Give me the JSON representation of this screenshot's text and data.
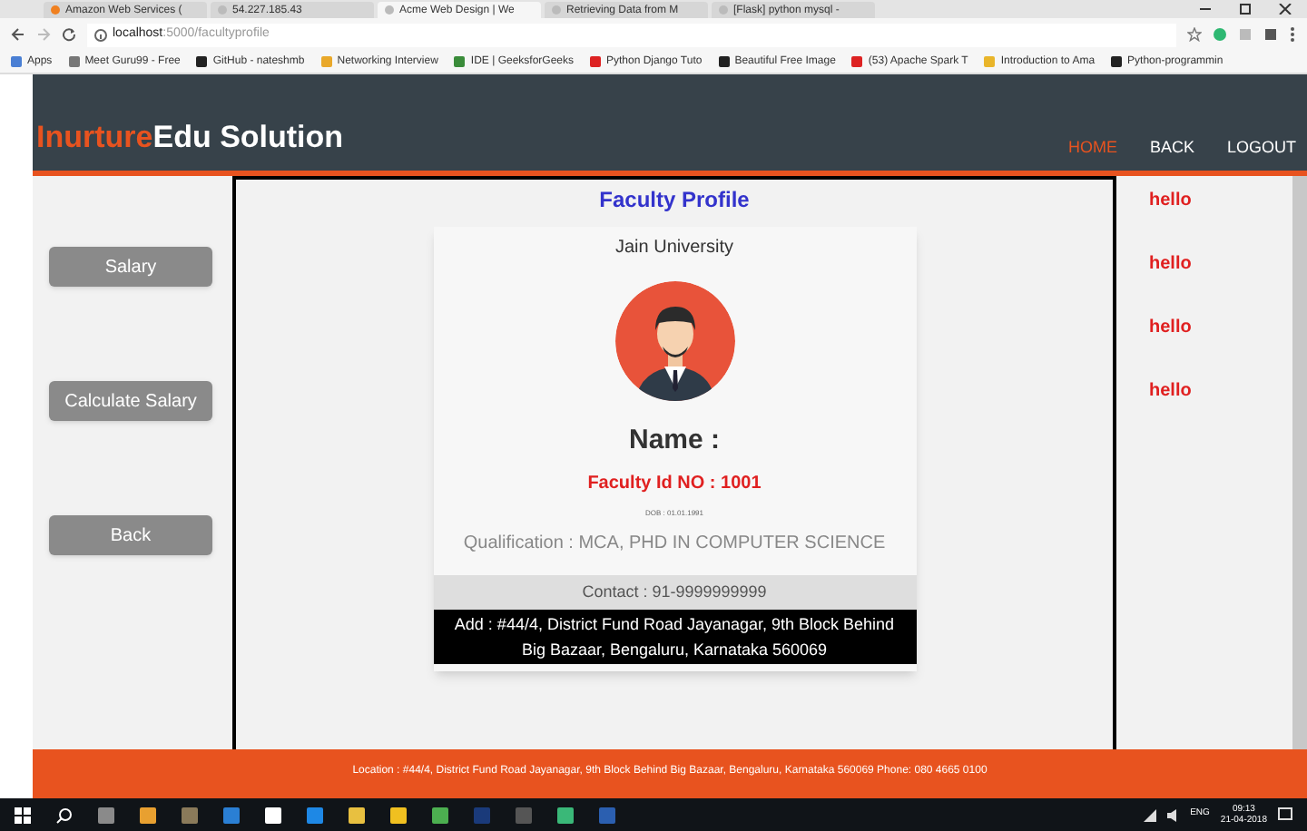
{
  "browser": {
    "tabs": [
      {
        "title": "Amazon Web Services (",
        "selected": false
      },
      {
        "title": "54.227.185.43",
        "selected": false
      },
      {
        "title": "Acme Web Design | We",
        "selected": true
      },
      {
        "title": "Retrieving Data from M",
        "selected": false
      },
      {
        "title": "[Flask] python mysql - ",
        "selected": false
      }
    ],
    "url_host": "localhost",
    "url_path": ":5000/facultyprofile",
    "bookmarks": [
      "Apps",
      "Meet Guru99 - Free",
      "GitHub - nateshmb",
      "Networking Interview",
      "IDE | GeeksforGeeks",
      "Python Django Tuto",
      "Beautiful Free Image",
      "(53) Apache Spark T",
      "Introduction to Ama",
      "Python-programmin"
    ]
  },
  "header": {
    "brand_accent": "Inurture",
    "brand": "Edu Solution",
    "nav": [
      {
        "label": "HOME",
        "selected": true
      },
      {
        "label": "BACK",
        "selected": false
      },
      {
        "label": "LOGOUT",
        "selected": false
      }
    ]
  },
  "sidebar": [
    "Salary",
    "Calculate Salary",
    "Back"
  ],
  "profile": {
    "heading": "Faculty Profile",
    "university": "Jain University",
    "name": "Name :",
    "faculty_id": "Faculty Id NO : 1001",
    "dob": "DOB : 01.01.1991",
    "qualification": "Qualification : MCA, PHD IN COMPUTER SCIENCE",
    "contact": "Contact : 91-9999999999",
    "address": "Add : #44/4, District Fund Road Jayanagar, 9th Block Behind Big Bazaar, Bengaluru, Karnataka 560069"
  },
  "right_notes": [
    "hello",
    "hello",
    "hello",
    "hello"
  ],
  "footer": "Location : #44/4, District Fund Road Jayanagar, 9th Block Behind Big Bazaar, Bengaluru, Karnataka 560069 Phone: 080 4665 0100",
  "taskbar": {
    "language": "ENG",
    "time": "09:13",
    "date": "21-04-2018"
  }
}
